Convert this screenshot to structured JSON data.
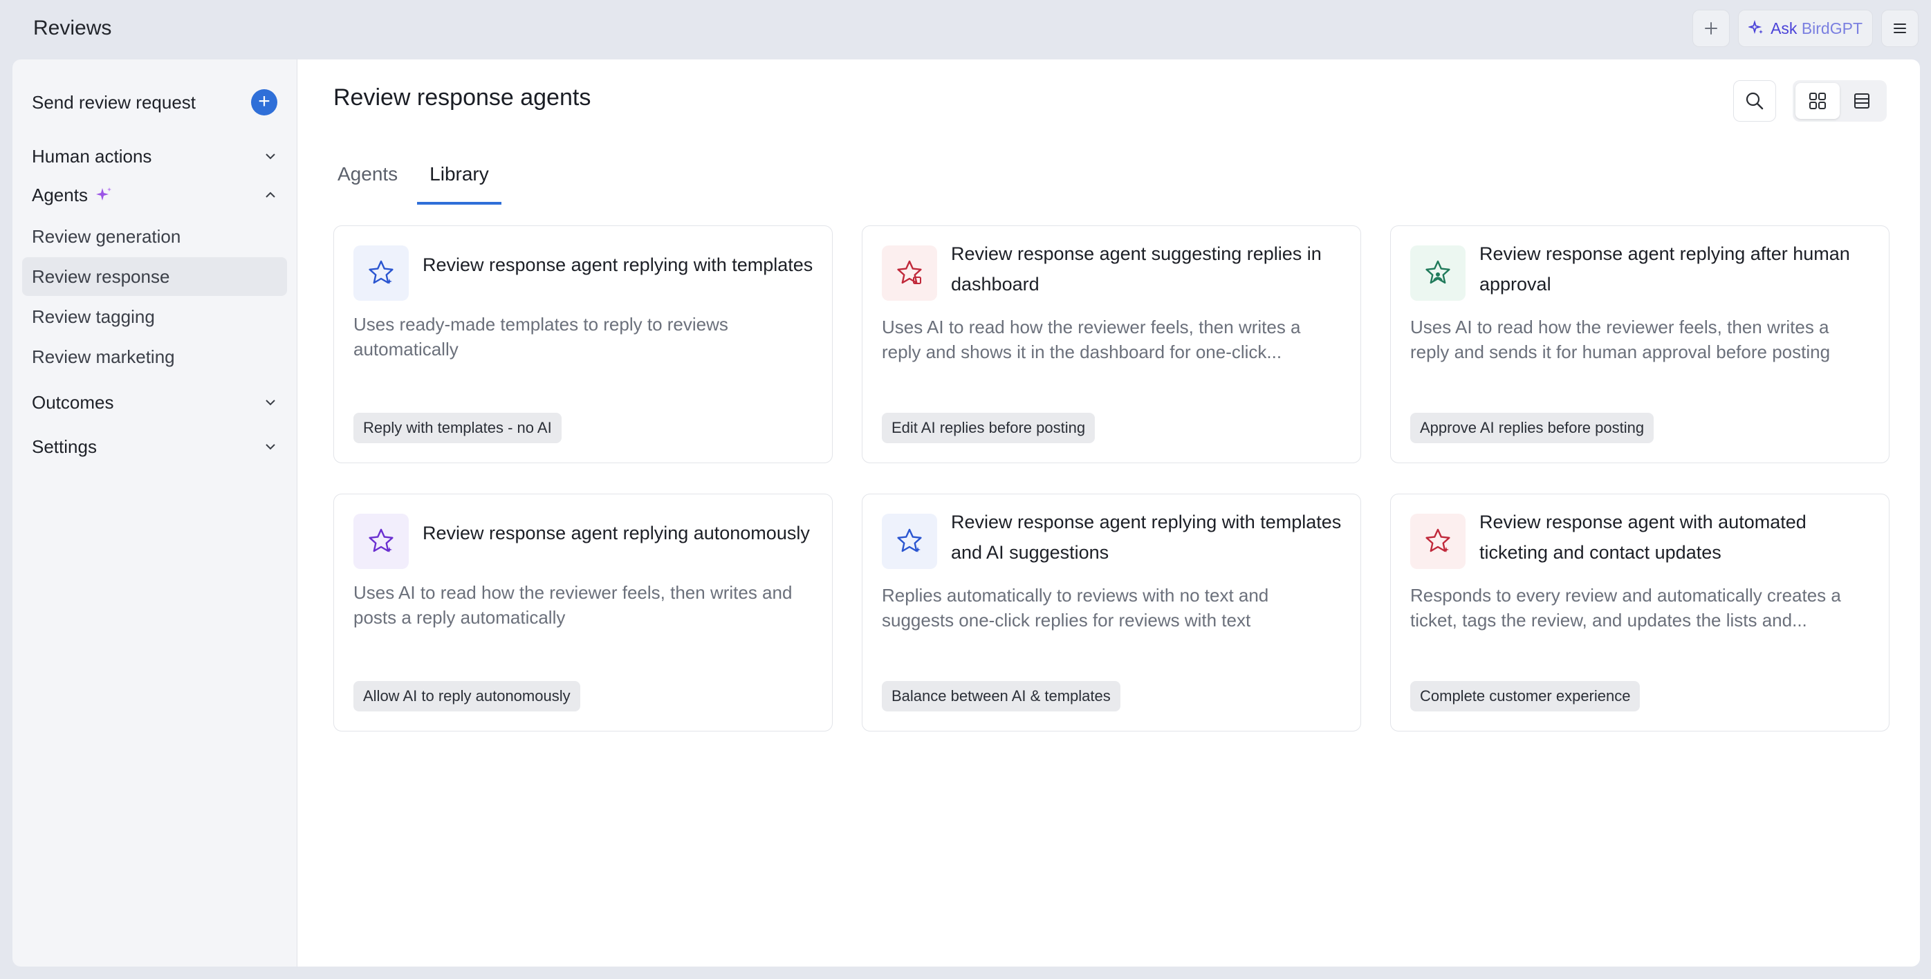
{
  "app": {
    "title": "Reviews"
  },
  "topbar": {
    "add_icon": "plus-icon",
    "ask_label": "Ask ",
    "ask_name": "BirdGPT",
    "menu_icon": "hamburger-icon"
  },
  "sidebar": {
    "send_request": "Send review request",
    "human_actions": "Human actions",
    "agents": "Agents",
    "agent_items": [
      "Review generation",
      "Review response",
      "Review tagging",
      "Review marketing"
    ],
    "outcomes": "Outcomes",
    "settings": "Settings"
  },
  "main": {
    "title": "Review response agents",
    "tabs": [
      "Agents",
      "Library"
    ],
    "active_tab": "Library"
  },
  "colors": {
    "accent": "#2f6fd8",
    "blue_icon": "#2a55d0",
    "red_icon": "#c0283a",
    "green_icon": "#1f7a5a",
    "purple_icon": "#6a2fd0"
  },
  "cards": [
    {
      "title": "Review response agent replying with templates",
      "desc": "Uses ready-made templates to reply to reviews automatically",
      "tag": "Reply with templates - no AI",
      "icon": "star-sparkle-icon"
    },
    {
      "title": "Review response agent suggesting replies in dashboard",
      "desc": "Uses AI to read how the reviewer feels, then writes a reply and shows it in the dashboard for one-click...",
      "tag": "Edit AI replies before posting",
      "icon": "star-dashboard-icon"
    },
    {
      "title": "Review response agent replying after human approval",
      "desc": "Uses AI to read how the reviewer feels, then writes a reply and sends it for human approval before posting",
      "tag": "Approve AI replies before posting",
      "icon": "star-person-icon"
    },
    {
      "title": "Review response agent replying autonomously",
      "desc": "Uses AI to read how the reviewer feels, then writes and posts a reply automatically",
      "tag": "Allow AI to reply autonomously",
      "icon": "star-sparkle-icon"
    },
    {
      "title": "Review response agent replying with templates and AI suggestions",
      "desc": "Replies automatically to reviews with no text and suggests one-click replies for reviews with text",
      "tag": "Balance between AI & templates",
      "icon": "star-sparkle-icon"
    },
    {
      "title": "Review response agent with automated ticketing and contact updates",
      "desc": "Responds to every review and automatically creates a ticket, tags the review, and updates the lists and...",
      "tag": "Complete customer experience",
      "icon": "star-sparkle-icon"
    }
  ]
}
